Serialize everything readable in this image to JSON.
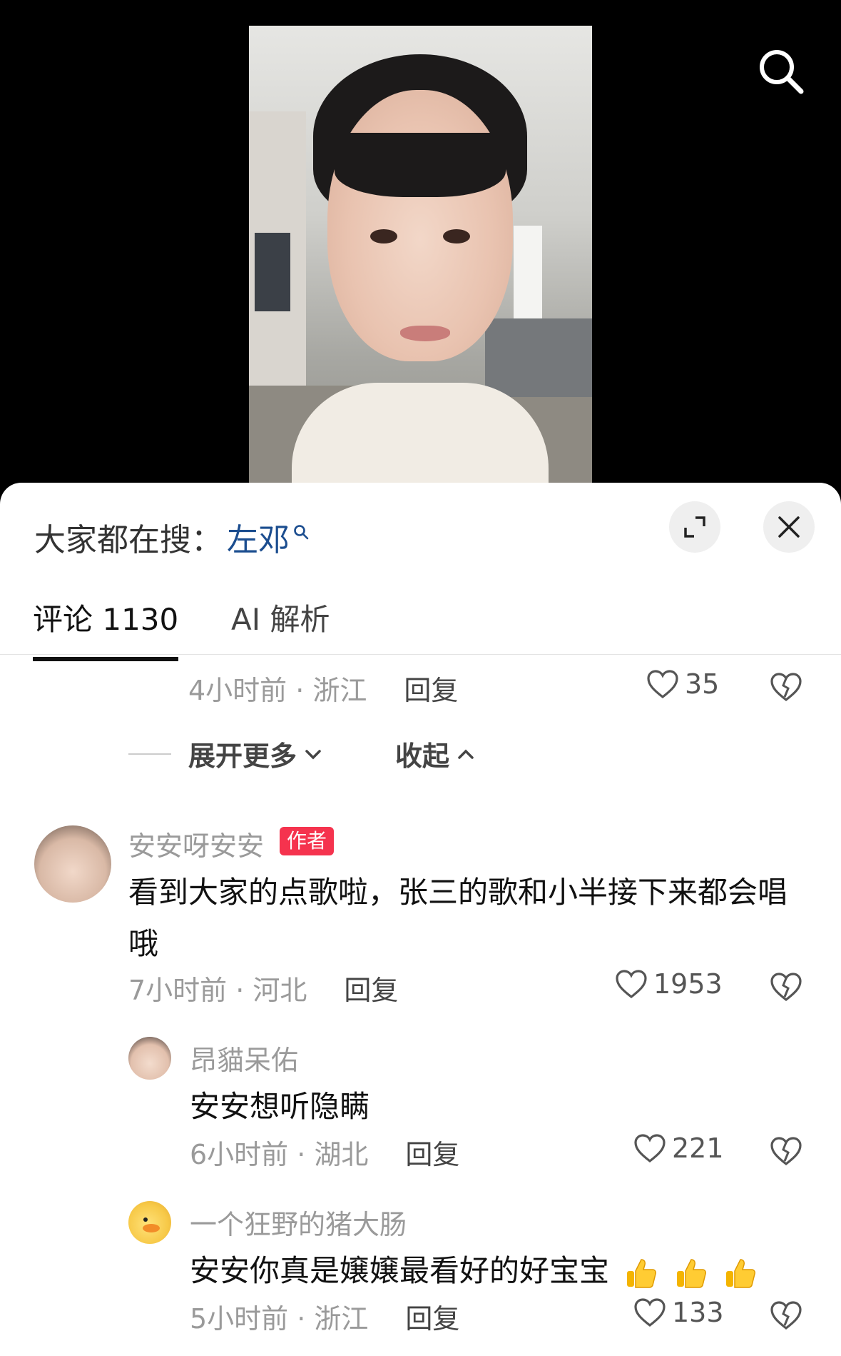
{
  "hot_search": {
    "prefix": "大家都在搜：",
    "term": "左邓"
  },
  "tabs": [
    {
      "label": "评论 1130"
    },
    {
      "label": "AI 解析"
    }
  ],
  "prev_comment_meta": {
    "time_location": "4小时前 · 浙江",
    "reply": "回复",
    "likes": "35"
  },
  "thread_controls": {
    "expand": "展开更多",
    "collapse": "收起"
  },
  "comments": [
    {
      "username": "安安呀安安",
      "badge": "作者",
      "text": "看到大家的点歌啦，张三的歌和小半接下来都会唱哦",
      "time_location": "7小时前 · 河北",
      "reply": "回复",
      "likes": "1953"
    },
    {
      "username": "昂貓呆佑",
      "text": "安安想听隐瞒",
      "time_location": "6小时前 · 湖北",
      "reply": "回复",
      "likes": "221"
    },
    {
      "username": "一个狂野的猪大肠",
      "text": "安安你真是嬢嬢最看好的好宝宝",
      "time_location": "5小时前 · 浙江",
      "reply": "回复",
      "likes": "133"
    }
  ],
  "colors": {
    "accent_blue": "#1b4d8f",
    "badge_red": "#f5334e"
  }
}
